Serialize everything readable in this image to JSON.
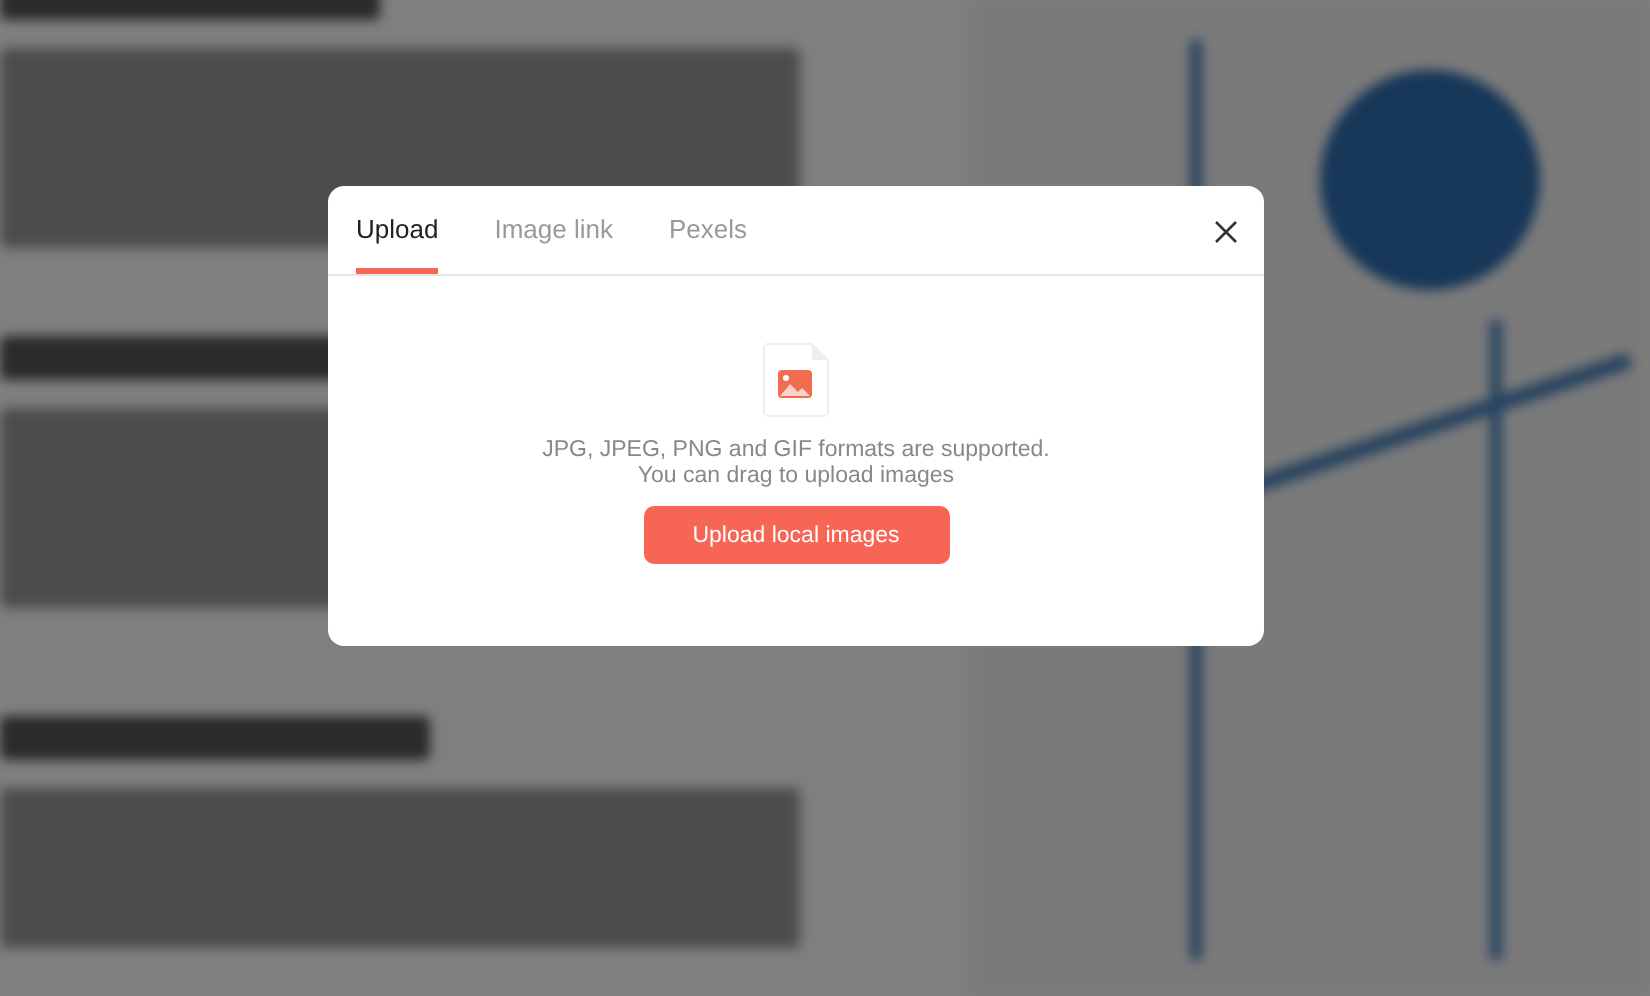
{
  "dialog": {
    "tabs": [
      {
        "label": "Upload",
        "selected": true
      },
      {
        "label": "Image link",
        "selected": false
      },
      {
        "label": "Pexels",
        "selected": false
      }
    ],
    "hint": "JPG, JPEG, PNG and GIF formats are supported. You can drag to upload images",
    "upload_button": "Upload local images"
  }
}
